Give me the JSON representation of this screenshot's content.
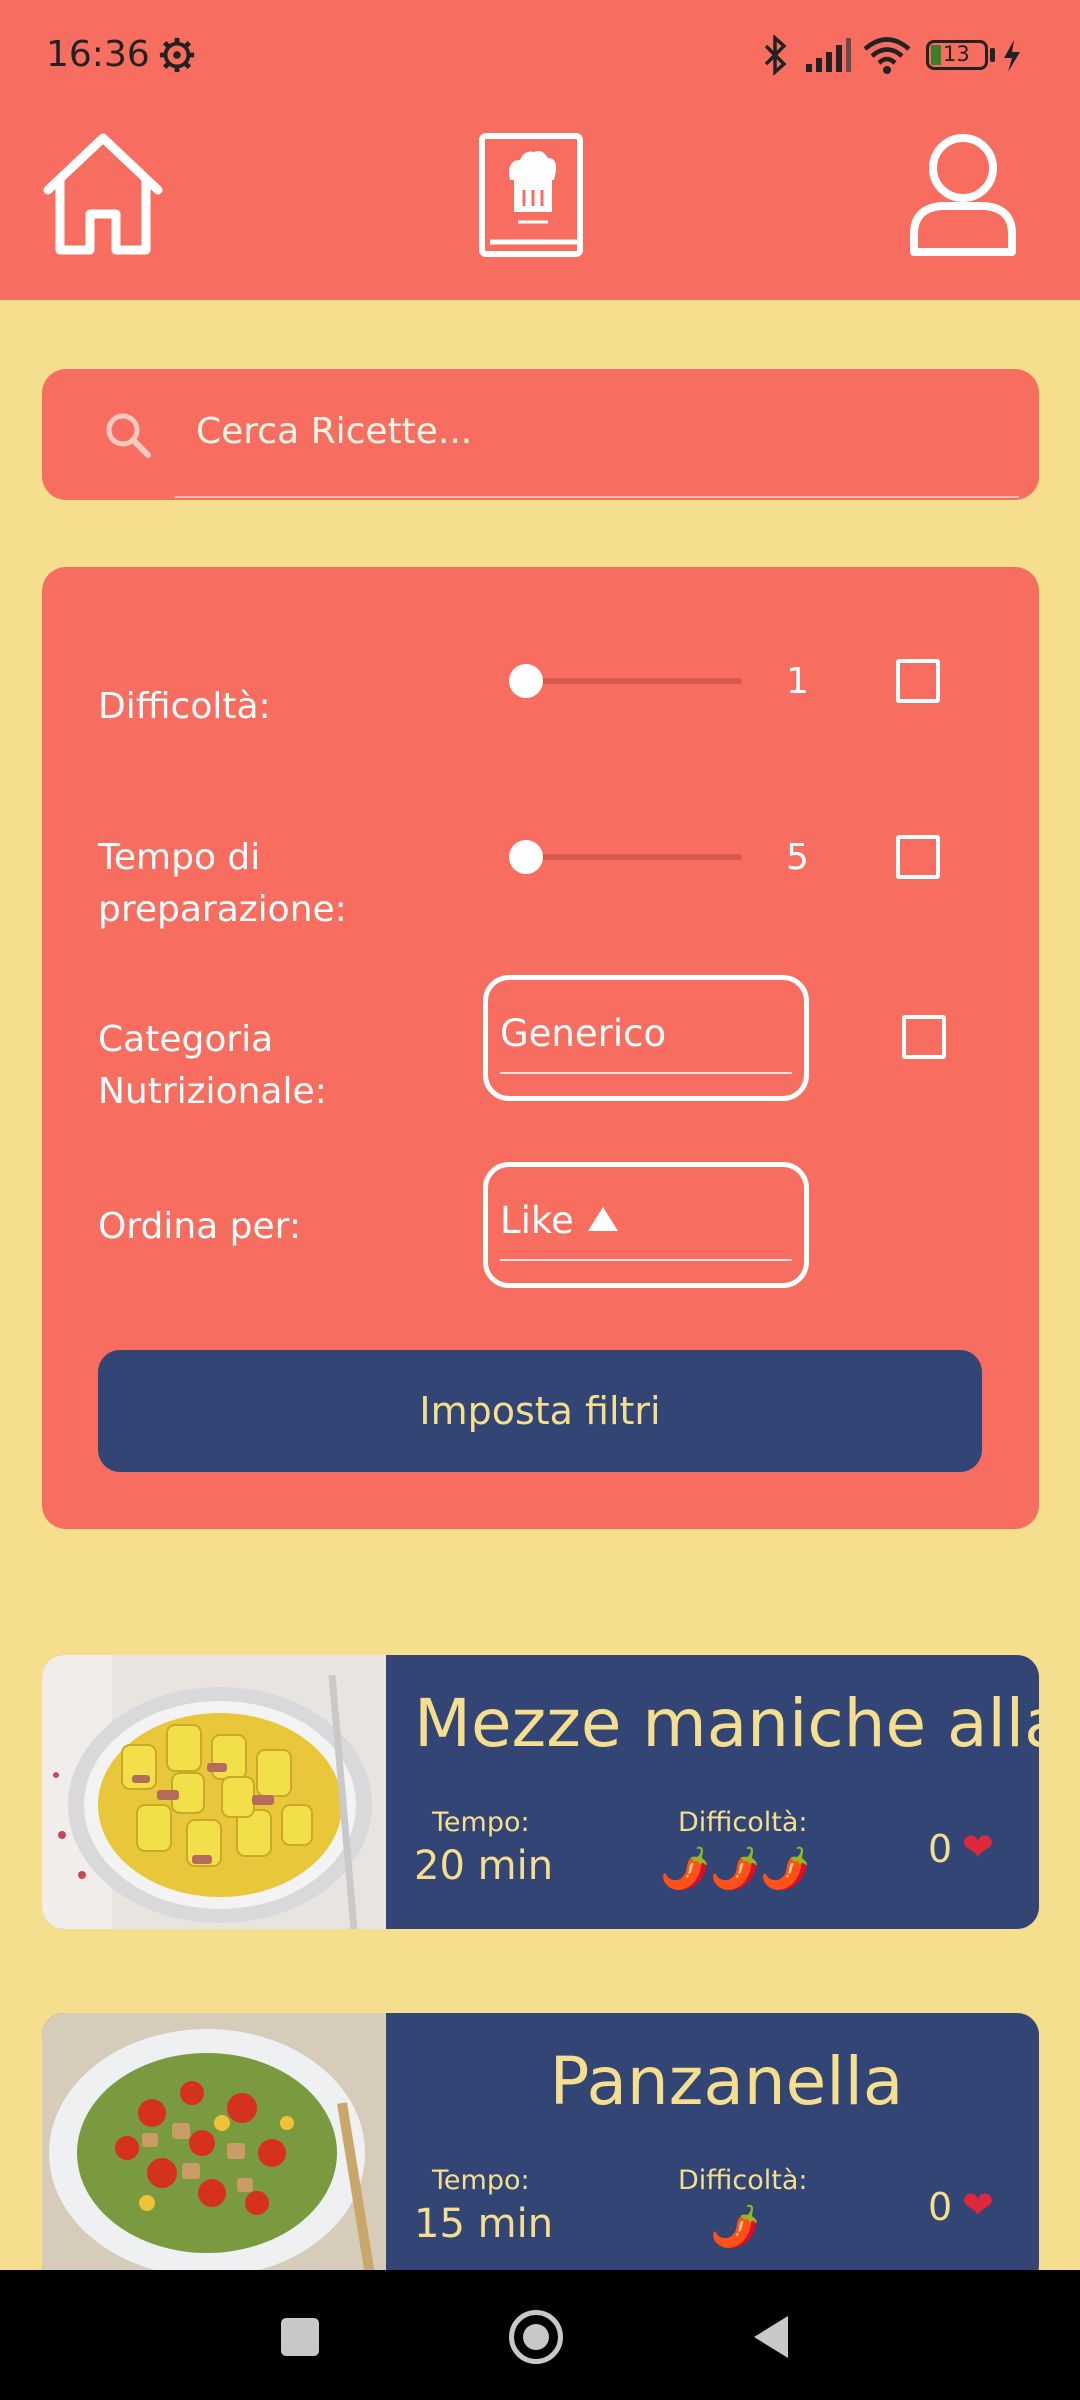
{
  "status": {
    "time": "16:36",
    "battery": "13"
  },
  "nav": {
    "home_icon": "home-icon",
    "recipes_icon": "chef-book-icon",
    "profile_icon": "user-icon"
  },
  "search": {
    "placeholder": "Cerca Ricette..."
  },
  "filters": {
    "difficulty": {
      "label": "Difficoltà:",
      "value": "1",
      "slider_level": 0,
      "checked": false
    },
    "prep_time": {
      "label_line1": "Tempo di",
      "label_line2": "preparazione:",
      "value": "5",
      "slider_level": 0,
      "checked": false
    },
    "category": {
      "label_line1": "Categoria",
      "label_line2": "Nutrizionale:",
      "selected": "Generico",
      "checked": false
    },
    "sort": {
      "label": "Ordina per:",
      "selected": "Like"
    },
    "apply_label": "Imposta filtri"
  },
  "recipes": [
    {
      "title": "Mezze maniche alla",
      "time_label": "Tempo:",
      "time_value": "20 min",
      "difficulty_label": "Difficoltà:",
      "difficulty": 3,
      "likes": "0"
    },
    {
      "title": "Panzanella",
      "time_label": "Tempo:",
      "time_value": "15 min",
      "difficulty_label": "Difficoltà:",
      "difficulty": 1,
      "likes": "0"
    }
  ],
  "colors": {
    "primary": "#F76E61",
    "background": "#F5DE8E",
    "accent": "#324574"
  }
}
